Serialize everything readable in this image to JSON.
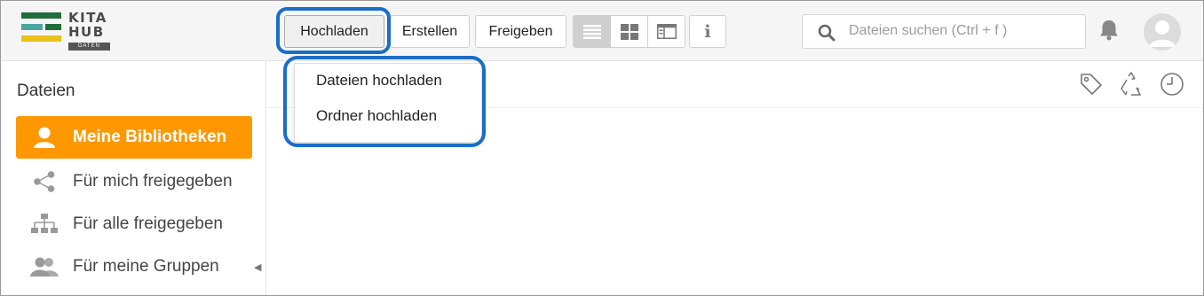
{
  "logo": {
    "line1": "KITA",
    "line2": "HUB",
    "badge": "DATEN",
    "colors": [
      "#1f6e3b",
      "#4aa7a0",
      "#e8c21a"
    ]
  },
  "toolbar": {
    "upload_label": "Hochladen",
    "create_label": "Erstellen",
    "share_label": "Freigeben",
    "info_label": "i",
    "view_icons": [
      "list-view-icon",
      "grid-view-icon",
      "detail-view-icon"
    ]
  },
  "upload_menu": {
    "items": [
      "Dateien hochladen",
      "Ordner hochladen"
    ]
  },
  "search": {
    "placeholder": "Dateien suchen (Ctrl + f )",
    "value": ""
  },
  "sidebar": {
    "title": "Dateien",
    "items": [
      {
        "label": "Meine Bibliotheken",
        "icon": "user-icon",
        "active": true
      },
      {
        "label": "Für mich freigegeben",
        "icon": "share-icon"
      },
      {
        "label": "Für alle freigegeben",
        "icon": "org-tree-icon"
      },
      {
        "label": "Für meine Gruppen",
        "icon": "group-icon"
      }
    ]
  },
  "content_toolbar": {
    "icons": [
      "tag-icon",
      "recycle-icon",
      "clock-icon"
    ]
  },
  "colors": {
    "accent": "#ff9800",
    "highlight": "#1a6dc8"
  }
}
